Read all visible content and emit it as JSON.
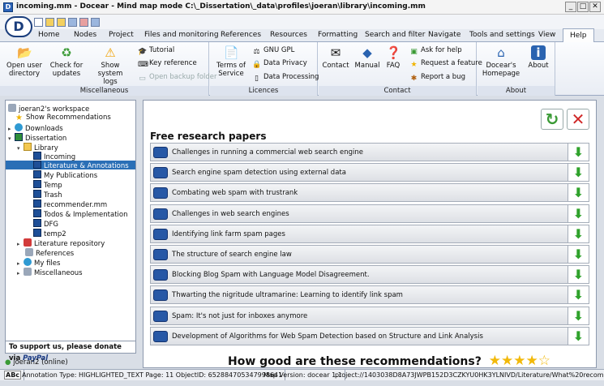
{
  "window": {
    "title": "incoming.mm - Docear - Mind map mode C:\\_Dissertation\\_data\\profiles\\joeran\\library\\incoming.mm",
    "app_letter": "D"
  },
  "tabs": [
    "Home",
    "Nodes",
    "Project",
    "Files and monitoring",
    "References",
    "Resources",
    "Formatting",
    "Search and filter",
    "Navigate",
    "Tools and settings",
    "View",
    "Help"
  ],
  "ribbon": {
    "miscellaneous": {
      "label": "Miscellaneous",
      "open_user_dir": [
        "Open user",
        "directory"
      ],
      "check_updates": [
        "Check for",
        "updates"
      ],
      "show_logs": [
        "Show system",
        "logs"
      ],
      "tutorial": "Tutorial",
      "key_reference": "Key reference",
      "open_backup": "Open backup folder"
    },
    "licences": {
      "label": "Licences",
      "terms": [
        "Terms of",
        "Service"
      ],
      "gnu": "GNU GPL",
      "privacy": "Data Privacy",
      "processing": "Data Processing"
    },
    "contact": {
      "label": "Contact",
      "contact": "Contact",
      "manual": "Manual",
      "faq": "FAQ",
      "ask_help": "Ask for help",
      "request_feature": "Request a feature",
      "report_bug": "Report a bug"
    },
    "about": {
      "label": "About",
      "homepage": [
        "Docear's",
        "Homepage"
      ],
      "about": "About"
    }
  },
  "sidebar": {
    "workspace": "joeran2's workspace",
    "show_recs": "Show Recommendations",
    "downloads": "Downloads",
    "dissertation": "Dissertation",
    "library": "Library",
    "library_items": [
      "Incoming",
      "Literature & Annotations",
      "My Publications",
      "Temp",
      "Trash",
      "recommender.mm",
      "Todos & Implementation",
      "DFG",
      "temp2"
    ],
    "lit_repo": "Literature repository",
    "references": "References",
    "my_files": "My files",
    "misc": "Miscellaneous",
    "support_text": "To support us, please donate via",
    "paypal": "PayPal",
    "online": "joeran2 (online)"
  },
  "main": {
    "title": "Free research papers",
    "papers": [
      "Challenges in running a commercial web search engine",
      "Search engine spam detection using external data",
      "Combating web spam with trustrank",
      "Challenges in web search engines",
      "Identifying link farm spam pages",
      "The structure of search engine law",
      "Blocking Blog Spam with Language Model Disagreement.",
      "Thwarting the nigritude ultramarine: Learning to identify link spam",
      "Spam: It's not just for inboxes anymore",
      "Development of Algorithms for Web Spam Detection based on Structure and Link Analysis"
    ],
    "rating_prompt": "How good are these recommendations?",
    "rating": 4,
    "rating_max": 5
  },
  "status": {
    "abc": "ABc",
    "annotation": "Annotation Type: HIGHLIGHTED_TEXT Page: 11 ObjectID: 652884705347998641",
    "map_version": "Map Version: docear 1.1",
    "project": "project://1403038D8A73JWPB152D3CZKYU0HK3YLNIVD/Literature/What%20recommend"
  }
}
